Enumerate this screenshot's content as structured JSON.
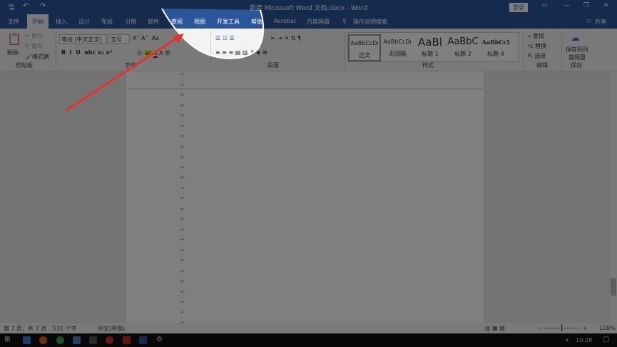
{
  "title": "新建 Microsoft Word 文档.docx - Word",
  "login": "登录",
  "tabs": [
    "文件",
    "开始",
    "插入",
    "设计",
    "布局",
    "引用",
    "邮件",
    "审阅",
    "视图",
    "开发工具",
    "帮助",
    "Acrobat",
    "百度网盘"
  ],
  "search": "操作说明搜索",
  "share": "共享",
  "clipboard": {
    "paste": "粘贴",
    "cut": "剪切",
    "copy": "复制",
    "format_painter": "格式刷",
    "label": "剪贴板"
  },
  "font": {
    "name": "等线 (中文正文)",
    "size": "五号",
    "label": "字体"
  },
  "paragraph": {
    "label": "段落"
  },
  "styles": {
    "items": [
      {
        "preview": "AaBbCcDı",
        "name": "正文"
      },
      {
        "preview": "AaBbCcDı",
        "name": "无间隔"
      },
      {
        "preview": "AaBl",
        "name": "标题 1"
      },
      {
        "preview": "AaBbC",
        "name": "标题 2"
      },
      {
        "preview": "AaBbCcI",
        "name": "标题 4"
      }
    ],
    "label": "样式"
  },
  "editing": {
    "find": "查找",
    "replace": "替换",
    "select": "选择",
    "label": "编辑"
  },
  "save": {
    "button": "保存到百度网盘",
    "label": "保存"
  },
  "status": {
    "page": "第 7 页，共 7 页",
    "words": "531 个字",
    "lang": "中文(中国)",
    "zoom": "100%"
  },
  "clock": "10:28",
  "colors": {
    "brand": "#2b579a",
    "arrow": "#e8312f"
  }
}
